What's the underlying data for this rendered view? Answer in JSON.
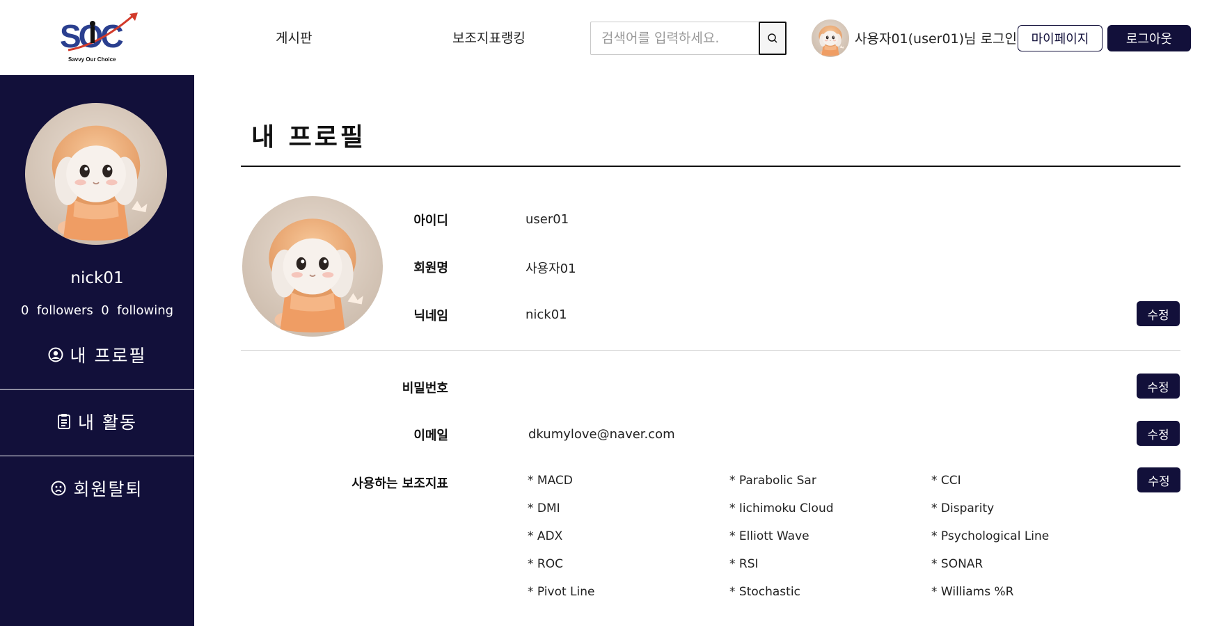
{
  "header": {
    "logo_text": "SOC",
    "logo_tagline": "Savvy Our Choice",
    "nav": [
      "게시판",
      "보조지표랭킹"
    ],
    "search_placeholder": "검색어를 입력하세요.",
    "login_text": "사용자01(user01)님 로그인",
    "mypage_label": "마이페이지",
    "logout_label": "로그아웃"
  },
  "sidebar": {
    "nickname": "nick01",
    "followers_text": "0  followers  0  following",
    "items": [
      {
        "label": "내 프로필",
        "icon": "user-circle-icon"
      },
      {
        "label": "내 활동",
        "icon": "clipboard-icon"
      },
      {
        "label": "회원탈퇴",
        "icon": "sad-face-icon"
      }
    ]
  },
  "profile": {
    "title": "내 프로필",
    "fields": {
      "id": {
        "label": "아이디",
        "value": "user01"
      },
      "name": {
        "label": "회원명",
        "value": "사용자01"
      },
      "nickname": {
        "label": "닉네임",
        "value": "nick01"
      },
      "password": {
        "label": "비밀번호",
        "value": ""
      },
      "email": {
        "label": "이메일",
        "value": "dkumylove@naver.com"
      },
      "indicators_label": "사용하는 보조지표"
    },
    "edit_label": "수정",
    "indicators": [
      [
        "* MACD",
        "* Parabolic Sar",
        "* CCI"
      ],
      [
        "* DMI",
        "* Iichimoku Cloud",
        "* Disparity"
      ],
      [
        "* ADX",
        "* Elliott Wave",
        "* Psychological Line"
      ],
      [
        "* ROC",
        "* RSI",
        "* SONAR"
      ],
      [
        "* Pivot Line",
        "* Stochastic",
        "* Williams %R"
      ]
    ]
  },
  "colors": {
    "navy": "#12103a",
    "white": "#ffffff"
  }
}
